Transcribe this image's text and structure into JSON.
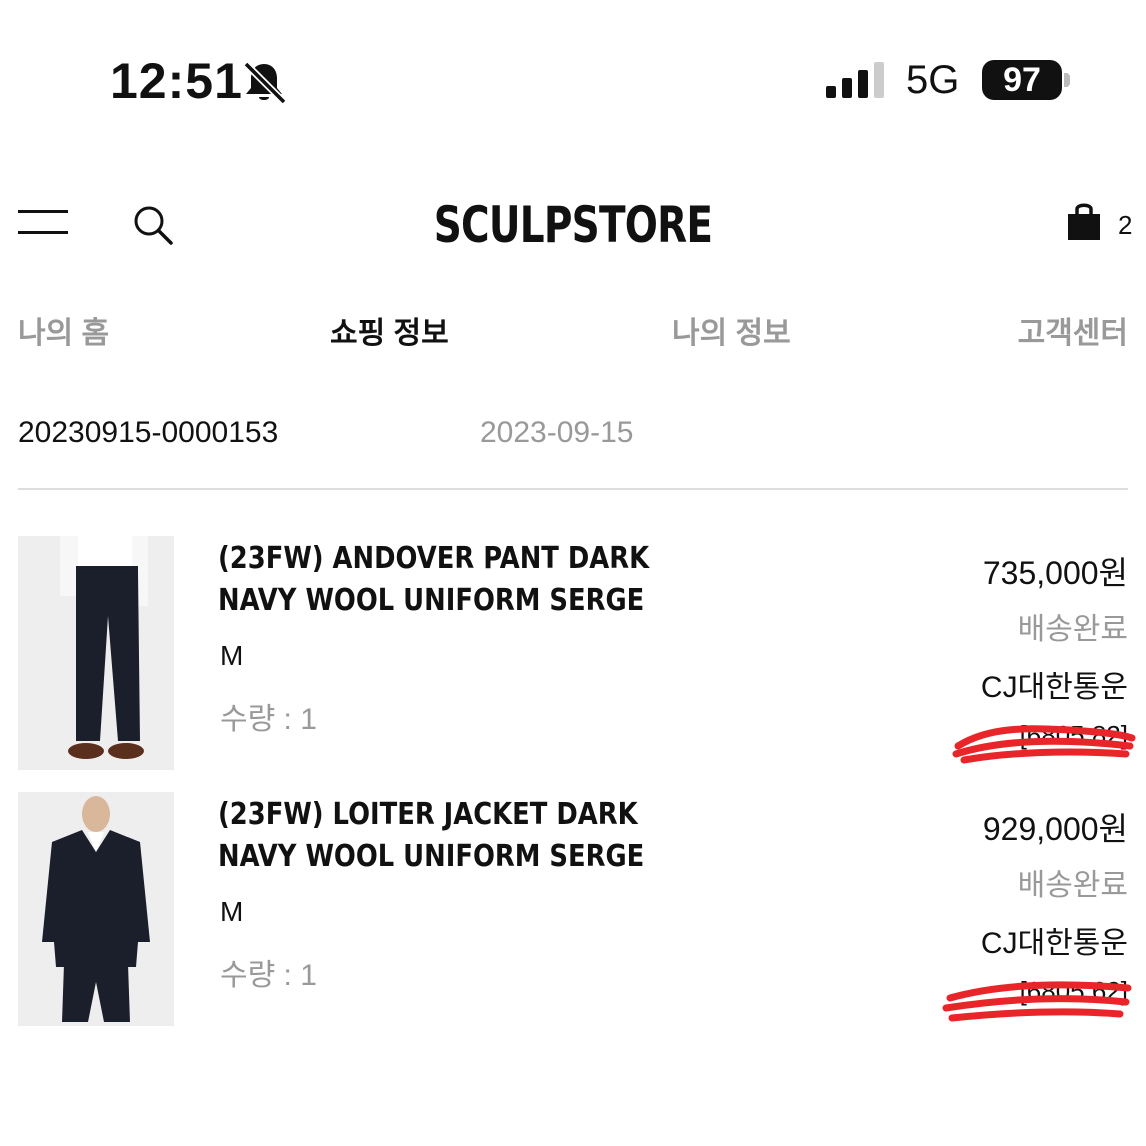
{
  "status_bar": {
    "time": "12:51",
    "network": "5G",
    "battery": "97",
    "icons": [
      "bell-slash-icon",
      "signal-icon",
      "battery-icon"
    ]
  },
  "header": {
    "logo": "SCULPSTORE",
    "cart_count": "2",
    "icons": [
      "menu-icon",
      "search-icon",
      "shopping-bag-icon"
    ]
  },
  "tabs": [
    {
      "label": "나의 홈"
    },
    {
      "label": "쇼핑 정보",
      "active": true
    },
    {
      "label": "나의 정보"
    },
    {
      "label": "고객센터"
    }
  ],
  "order": {
    "number": "20230915-0000153",
    "date": "2023-09-15"
  },
  "items": [
    {
      "name": "(23FW) ANDOVER PANT DARK NAVY WOOL UNIFORM SERGE",
      "size": "M",
      "quantity": "수량 : 1",
      "price": "735,000원",
      "status": "배송완료",
      "carrier": "CJ대한통운",
      "tracking": "[6805         82]"
    },
    {
      "name": "(23FW) LOITER JACKET DARK NAVY WOOL UNIFORM SERGE",
      "size": "M",
      "quantity": "수량 : 1",
      "price": "929,000원",
      "status": "배송완료",
      "carrier": "CJ대한통운",
      "tracking": "[6805         62]"
    }
  ],
  "colors": {
    "text": "#111111",
    "muted": "#999999",
    "divider": "#dddddd",
    "redaction": "#e8262a",
    "navy": "#1b1e2b"
  }
}
